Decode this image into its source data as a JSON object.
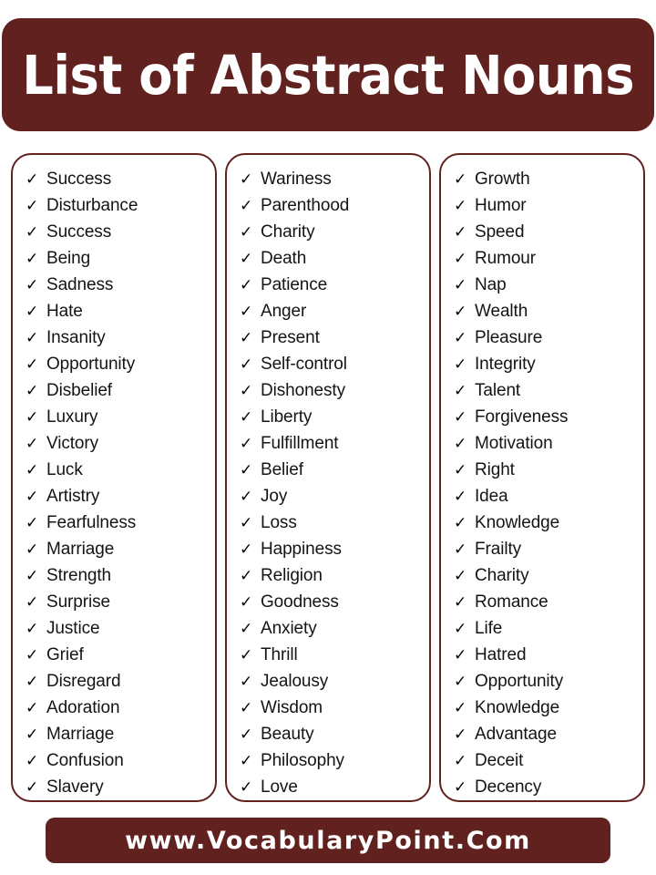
{
  "header": {
    "title": "List of Abstract Nouns",
    "background_color": "#60211F",
    "text_color": "#FFFFFF"
  },
  "footer": {
    "website": "www.VocabularyPoint.Com",
    "background_color": "#60211F",
    "text_color": "#FFFFFF"
  },
  "theme": {
    "accent_color": "#60211F",
    "page_background": "#FFFFFF",
    "text_color": "#141414",
    "bullet_icon": "check-icon",
    "bullet_glyph": "✓"
  },
  "columns": [
    {
      "id": "column-1",
      "items": [
        "Success",
        "Disturbance",
        "Success",
        "Being",
        "Sadness",
        "Hate",
        "Insanity",
        "Opportunity",
        "Disbelief",
        "Luxury",
        "Victory",
        "Luck",
        "Artistry",
        "Fearfulness",
        "Marriage",
        "Strength",
        "Surprise",
        "Justice",
        "Grief",
        "Disregard",
        "Adoration",
        "Marriage",
        "Confusion",
        "Slavery"
      ]
    },
    {
      "id": "column-2",
      "items": [
        "Wariness",
        "Parenthood",
        "Charity",
        "Death",
        "Patience",
        "Anger",
        "Present",
        "Self-control",
        "Dishonesty",
        "Liberty",
        "Fulfillment",
        "Belief",
        "Joy",
        "Loss",
        "Happiness",
        "Religion",
        "Goodness",
        "Anxiety",
        "Thrill",
        "Jealousy",
        "Wisdom",
        "Beauty",
        "Philosophy",
        "Love"
      ]
    },
    {
      "id": "column-3",
      "items": [
        "Growth",
        "Humor",
        "Speed",
        "Rumour",
        "Nap",
        "Wealth",
        "Pleasure",
        "Integrity",
        "Talent",
        "Forgiveness",
        "Motivation",
        "Right",
        "Idea",
        "Knowledge",
        "Frailty",
        "Charity",
        "Romance",
        "Life",
        "Hatred",
        "Opportunity",
        "Knowledge",
        "Advantage",
        "Deceit",
        "Decency"
      ]
    }
  ]
}
